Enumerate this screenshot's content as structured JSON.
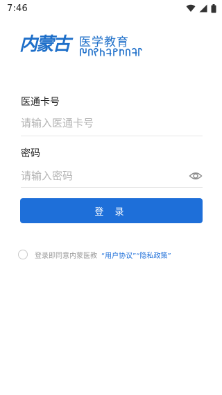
{
  "status_bar": {
    "time": "7:46"
  },
  "logo": {
    "script_text": "内蒙古",
    "title": "医学教育",
    "mongolian_text": "ᠮᠣᠩᠭᠣᠯ"
  },
  "form": {
    "account_label": "医通卡号",
    "account_placeholder": "请输入医通卡号",
    "password_label": "密码",
    "password_placeholder": "请输入密码",
    "login_button": "登 录"
  },
  "agreement": {
    "prefix": "登录即同意内蒙医教",
    "user_agreement": "“用户协议”",
    "privacy_policy": "“隐私政策”"
  },
  "colors": {
    "brand": "#1e6fd9",
    "placeholder": "#b3b3b3"
  },
  "icons": [
    "wifi-icon",
    "signal-icon",
    "battery-icon",
    "eye-icon"
  ]
}
